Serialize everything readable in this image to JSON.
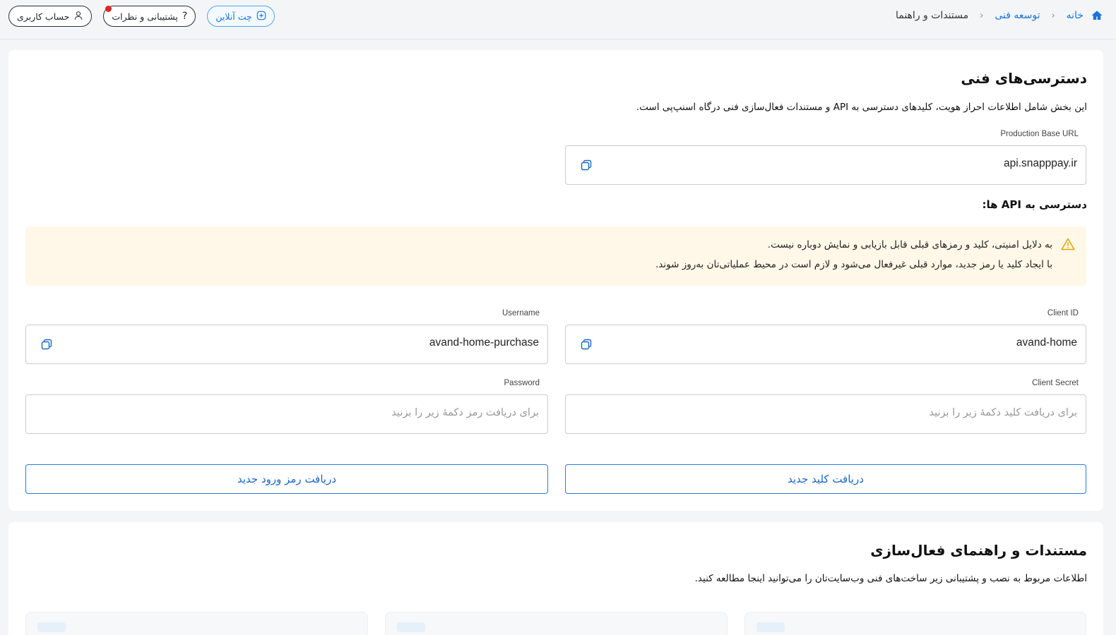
{
  "header": {
    "breadcrumb": [
      "خانه",
      "توسعه فنی",
      "مستندات و راهنما"
    ],
    "account_label": "حساب کاربری",
    "support_label": "پشتیبانی و نظرات",
    "chat_label": "چت آنلاین"
  },
  "technical": {
    "title": "دسترسی‌های فنی",
    "description": "این بخش شامل اطلاعات احراز هویت، کلیدهای دسترسی به API و مستندات فعال‌سازی فنی درگاه اسنپ‌پی است.",
    "base_url_label": "Production Base URL",
    "base_url_value": "api.snapppay.ir",
    "api_access_title": "دسترسی به API ها:",
    "alert_line1": "به دلایل امنیتی، کلید و رمزهای قبلی قابل بازیابی و نمایش دوباره نیست.",
    "alert_line2": "با ایجاد کلید یا رمز جدید، موارد قبلی غیرفعال می‌شود و لازم است در محیط عملیاتی‌تان به‌روز شوند.",
    "client_id_label": "Client ID",
    "client_id_value": "avand-home",
    "username_label": "Username",
    "username_value": "avand-home-purchase",
    "client_secret_label": "Client Secret",
    "client_secret_placeholder": "برای دریافت کلید دکمهٔ زیر را بزنید",
    "password_label": "Password",
    "password_placeholder": "برای دریافت رمز دکمهٔ زیر را بزنید",
    "new_key_button": "دریافت کلید جدید",
    "new_password_button": "دریافت رمز ورود جدید"
  },
  "docs": {
    "title": "مستندات و راهنمای فعال‌سازی",
    "description": "اطلاعات مربوط به نصب و پشتیبانی زیر ساخت‌های فنی وب‌سایت‌تان را می‌توانید اینجا مطالعه کنید."
  },
  "colors": {
    "accent": "#1a73d9",
    "alert_bg": "#fff8e8",
    "notification_dot": "#e02424"
  }
}
